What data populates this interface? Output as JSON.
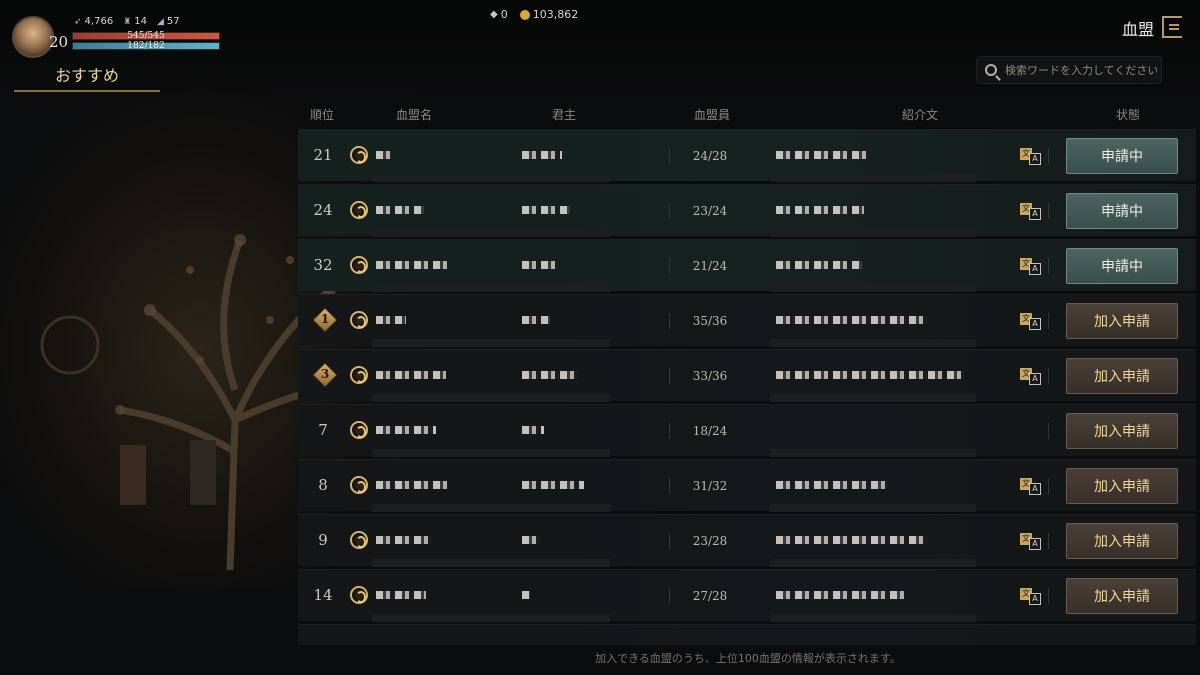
{
  "player": {
    "level": "20",
    "stat_power": "4,766",
    "stat_defense": "14",
    "stat_speed": "57",
    "hp": "545/545",
    "mp": "182/182",
    "hp_fill": 1.0,
    "mp_fill": 1.0
  },
  "tabs": {
    "recommend": "おすすめ"
  },
  "currency": {
    "gems": "0",
    "gold": "103,862"
  },
  "header": {
    "title": "血盟"
  },
  "search": {
    "placeholder": "検索ワードを入力してください"
  },
  "table": {
    "columns": {
      "rank": "順位",
      "name": "血盟名",
      "lord": "君主",
      "members": "血盟員",
      "intro": "紹介文",
      "status": "状態"
    },
    "rows": [
      {
        "rank": "21",
        "members": "24/28",
        "status": "申請中",
        "state": "pending",
        "translate": true
      },
      {
        "rank": "24",
        "members": "23/24",
        "status": "申請中",
        "state": "pending",
        "translate": true
      },
      {
        "rank": "32",
        "members": "21/24",
        "status": "申請中",
        "state": "pending",
        "translate": true
      },
      {
        "rank": "1",
        "members": "35/36",
        "status": "加入申請",
        "state": "join",
        "translate": true,
        "badge": true
      },
      {
        "rank": "3",
        "members": "33/36",
        "status": "加入申請",
        "state": "join",
        "translate": true,
        "badge": true
      },
      {
        "rank": "7",
        "members": "18/24",
        "status": "加入申請",
        "state": "join",
        "translate": false
      },
      {
        "rank": "8",
        "members": "31/32",
        "status": "加入申請",
        "state": "join",
        "translate": true
      },
      {
        "rank": "9",
        "members": "23/28",
        "status": "加入申請",
        "state": "join",
        "translate": true
      },
      {
        "rank": "14",
        "members": "27/28",
        "status": "加入申請",
        "state": "join",
        "translate": true
      }
    ]
  },
  "footer": {
    "note": "加入できる血盟のうち、上位100血盟の情報が表示されます。"
  },
  "colors": {
    "pending_button": "#445b56",
    "join_button": "#413831",
    "gold_text": "#f2d79b"
  }
}
